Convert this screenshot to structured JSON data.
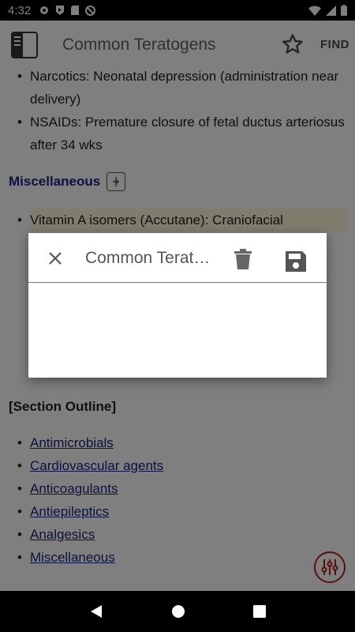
{
  "status": {
    "time": "4:32"
  },
  "appbar": {
    "title": "Common Teratogens",
    "find_label": "FIND"
  },
  "content": {
    "top_items": [
      "Narcotics: Neonatal depression (administration near delivery)",
      "NSAIDs: Premature closure of fetal ductus arteriosus after 34 wks"
    ],
    "section_title": "Miscellaneous",
    "misc_items": [
      "Vitamin A isomers (Accutane): Craniofacial"
    ],
    "outline_title": "[Section Outline]",
    "outline_links": [
      "Antimicrobials",
      "Cardiovascular agents",
      "Anticoagulants",
      "Antiepileptics",
      "Analgesics",
      "Miscellaneous"
    ]
  },
  "dialog": {
    "title": "Common Teratogens"
  }
}
